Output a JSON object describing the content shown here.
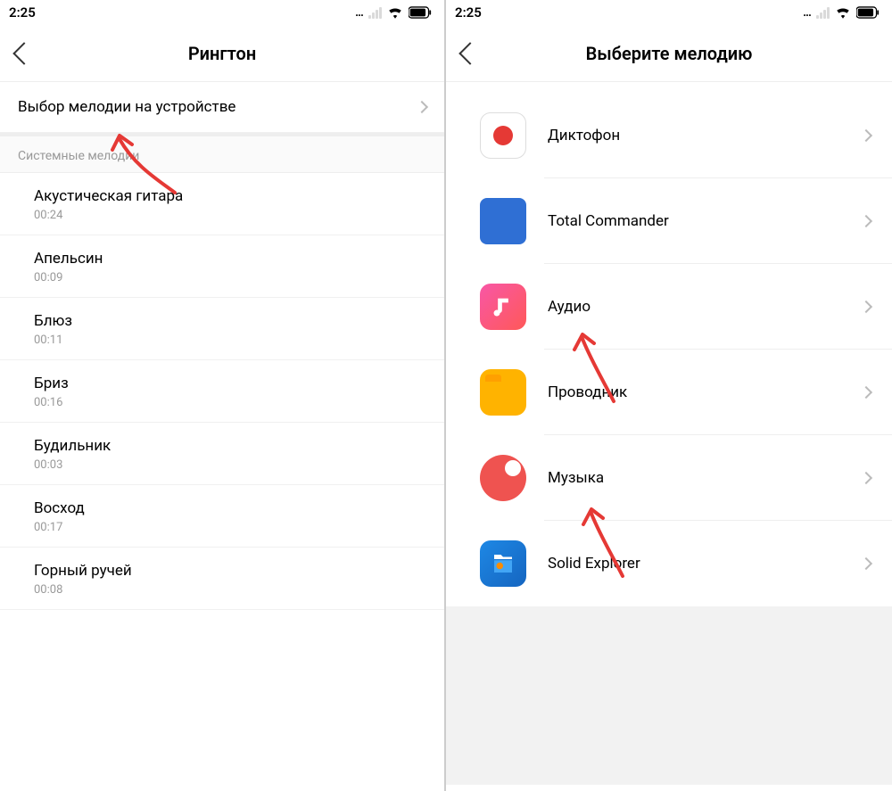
{
  "status": {
    "time": "2:25",
    "dots": "..."
  },
  "left": {
    "title": "Рингтон",
    "selectOnDevice": "Выбор мелодии на устройстве",
    "sectionHeader": "Системные мелодии",
    "songs": [
      {
        "title": "Акустическая гитара",
        "duration": "00:24"
      },
      {
        "title": "Апельсин",
        "duration": "00:09"
      },
      {
        "title": "Блюз",
        "duration": "00:11"
      },
      {
        "title": "Бриз",
        "duration": "00:16"
      },
      {
        "title": "Будильник",
        "duration": "00:03"
      },
      {
        "title": "Восход",
        "duration": "00:17"
      },
      {
        "title": "Горный ручей",
        "duration": "00:08"
      }
    ]
  },
  "right": {
    "title": "Выберите мелодию",
    "apps": [
      {
        "label": "Диктофон",
        "icon": "recorder"
      },
      {
        "label": "Total Commander",
        "icon": "tc"
      },
      {
        "label": "Аудио",
        "icon": "audio"
      },
      {
        "label": "Проводник",
        "icon": "explorer"
      },
      {
        "label": "Музыка",
        "icon": "music"
      },
      {
        "label": "Solid Explorer",
        "icon": "solid"
      }
    ]
  }
}
